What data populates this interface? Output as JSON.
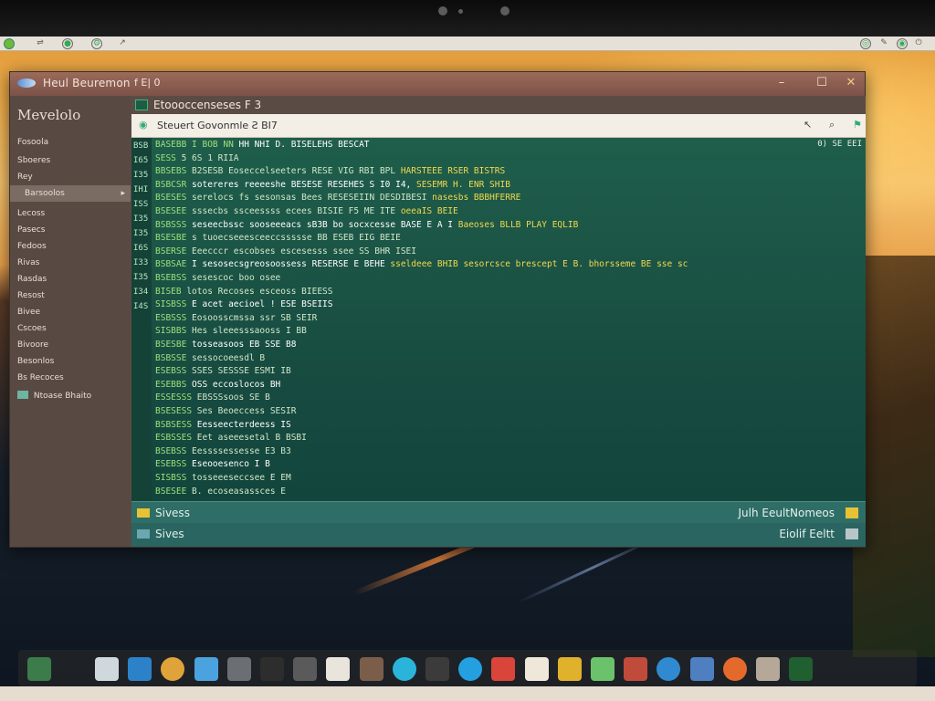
{
  "window": {
    "title": "Heul Beuremon",
    "title_extra": "f  E|  0",
    "controls": {
      "minimize": "–",
      "maximize": "☐",
      "close": "✕"
    }
  },
  "sidebar": {
    "heading": "Mevelolo",
    "items": [
      {
        "label": "Fosoola"
      },
      {
        "label": "Sboeres"
      },
      {
        "label": "Rey"
      },
      {
        "label": "Barsoolos"
      },
      {
        "label": "Lecoss"
      },
      {
        "label": "Pasecs"
      },
      {
        "label": "Fedoos"
      },
      {
        "label": "Rivas"
      },
      {
        "label": "Rasdas"
      },
      {
        "label": "Resost"
      },
      {
        "label": "Bivee"
      },
      {
        "label": "Cscoes"
      },
      {
        "label": "Bivoore"
      },
      {
        "label": "Besonlos"
      },
      {
        "label": "Bs Recoces"
      },
      {
        "label": "Ntoase Bhaito"
      }
    ]
  },
  "editor": {
    "header": "Etoooccenseses  F  3",
    "path": "Steuert Govonmle  Ƨ  BI7",
    "right_info": "0)  SE  EEI",
    "line_numbers": [
      "BSB",
      "I65",
      "I35",
      "IHI",
      "ISS",
      "I35",
      "I35",
      "I6S",
      "I33",
      "I35",
      "I34",
      "I4S"
    ],
    "lines": [
      {
        "a": "BASEBB  I BOB  NN  ",
        "b": "HH  NHI  D.  BISELEHS  BESCAT",
        "c": ""
      },
      {
        "a": "SESS  ",
        "b": "5 6S  1 RIIA",
        "c": ""
      },
      {
        "a": "BBSEBS  ",
        "b": "B2SESB  Eoseccelseeters  RESE  VIG  RBI  BPL",
        "c": "  HARSTEEE  RSER  BISTRS"
      },
      {
        "a": "BSBCSR  ",
        "b": "sotereres  reeeeshe  BESESE  RESEHES  S  I0   I4,",
        "c": "  SESEMR  H.  ENR  SHIB"
      },
      {
        "a": "BSESES  ",
        "b": "serelocs  fs  sesonsas  Bees  RESESEIIN  DESDIBESI",
        "c": "  nasesbs  BBBHFERRE"
      },
      {
        "a": "BSESEE  ",
        "b": "sssecbs  ssceessss  ecees  BISIE  F5  ME  ITE",
        "c": "  oeeaIS  BEIE"
      },
      {
        "a": "BSBSSS  ",
        "b": "seseecbssc  sooseeeacs  sB3B  bo  socxcesse  BASE  E  A  I",
        "c": "  Baeoses  BLLB  PLAY  EQLIB"
      },
      {
        "a": "BSESBE  ",
        "b": "s  tuoecseeesceeccssssse  BB  ESEB  EIG  BEIE",
        "c": ""
      },
      {
        "a": "BSERSE  ",
        "b": "Eeecccr  escobses  escesesss  ssee  SS  BHR  ISEI",
        "c": ""
      },
      {
        "a": "BSBSAE  ",
        "b": "I  sesosecsgreosoossess  RESERSE  E  BEHE",
        "c": "  sseldeee  BHIB  sesorcsce  brescept  E  B.  bhorsseme  BE  sse  sc"
      },
      {
        "a": "BSEBSS  ",
        "b": "sesescoc  boo  osee  ",
        "c": ""
      },
      {
        "a": "BISEB  ",
        "b": "lotos  Recoses  esceoss  BIEESS",
        "c": ""
      },
      {
        "a": "SISBSS  ",
        "b": "E  acet  aecioel  !  ESE  BSEIIS",
        "c": ""
      },
      {
        "a": "ESBSSS  ",
        "b": "Eosoosscmssa  ssr  SB  SEIR",
        "c": ""
      },
      {
        "a": "SISBBS  ",
        "b": "Hes  sleeesssaooss  I  BB",
        "c": ""
      },
      {
        "a": "BSESBE  ",
        "b": "tosseasoos  EB  SSE  B8",
        "c": ""
      },
      {
        "a": "BSBSSE  ",
        "b": "sessocoeesdl  B",
        "c": ""
      },
      {
        "a": "ESEBSS  ",
        "b": "SSES  SESSSE  ESMI  IB",
        "c": ""
      },
      {
        "a": "ESEBBS  ",
        "b": "OSS  eccoslocos  BH",
        "c": ""
      },
      {
        "a": "ESSESSS  ",
        "b": "EBSSSsoos  SE  B",
        "c": ""
      },
      {
        "a": "BSESESS  ",
        "b": "Ses  Beoeccess  SESIR",
        "c": ""
      },
      {
        "a": "BSBSESS  ",
        "b": "Eesseecterdeess  IS",
        "c": ""
      },
      {
        "a": "ESBSSES  ",
        "b": "Eet  aseeesetal  B  BSBI",
        "c": ""
      },
      {
        "a": "BSEBSS  ",
        "b": "Eessssessesse  E3  B3",
        "c": ""
      },
      {
        "a": "ESEBSS  ",
        "b": "Eseooesenco  I  B",
        "c": ""
      },
      {
        "a": "SISBSS  ",
        "b": "tosseeeseccsee  E  EM",
        "c": ""
      },
      {
        "a": "BSESEE  ",
        "b": "B.  ecoseasassces  E",
        "c": ""
      }
    ]
  },
  "status": {
    "row1_left": "Sivess",
    "row1_right": "Julh  EeultNomeos",
    "row2_left": "Sives",
    "row2_right": "Eiolif  Eeltt"
  },
  "dock": {
    "items": [
      "terminal-icon",
      "file-manager-icon",
      "settings-icon",
      "shield-icon",
      "package-icon",
      "browser-icon",
      "monitor-icon",
      "document-icon",
      "pen-icon",
      "photo-icon",
      "chat-icon",
      "music-icon",
      "globe-icon",
      "notes-icon",
      "calendar-icon",
      "chart-icon",
      "paint-icon",
      "mail-icon",
      "network-icon",
      "media-icon",
      "firefox-icon",
      "archive-icon",
      "terminal-green-icon"
    ]
  },
  "colors": {
    "terminal_bg": "#1f5e4b",
    "sidebar_bg": "#584a43",
    "titlebar": "#8b5d51",
    "status_bg": "#2f6e66"
  }
}
